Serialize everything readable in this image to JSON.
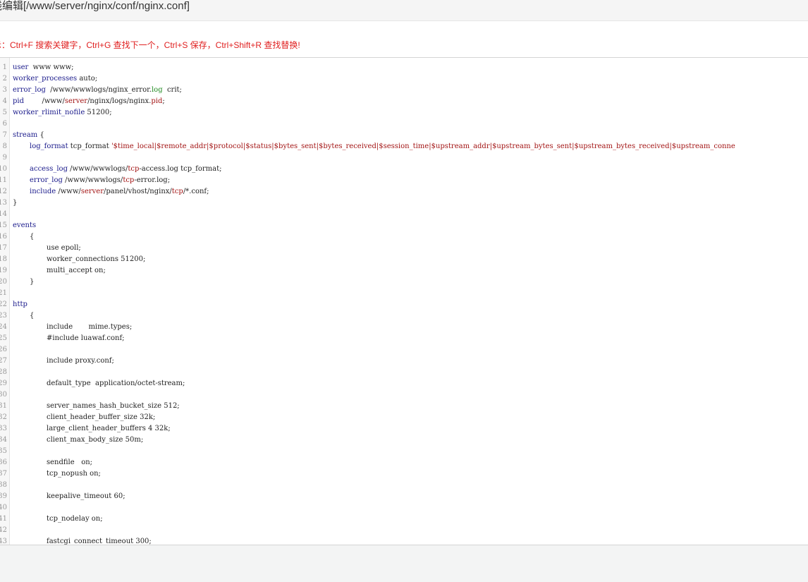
{
  "title": "线编辑[/www/server/nginx/conf/nginx.conf]",
  "tip": "示：Ctrl+F 搜索关键字，Ctrl+G 查找下一个，Ctrl+S 保存，Ctrl+Shift+R 查找替换!",
  "lines": [
    {
      "n": "1",
      "indent": 0,
      "parts": [
        {
          "t": "user",
          "c": "kw"
        },
        {
          "t": "  www www;",
          "c": "pth"
        }
      ]
    },
    {
      "n": "2",
      "indent": 0,
      "parts": [
        {
          "t": "worker_processes",
          "c": "kw"
        },
        {
          "t": " auto;",
          "c": "pth"
        }
      ]
    },
    {
      "n": "3",
      "indent": 0,
      "parts": [
        {
          "t": "error_log",
          "c": "kw"
        },
        {
          "t": "  /www/wwwlogs/nginx_error.",
          "c": "pth"
        },
        {
          "t": "log",
          "c": "grn"
        },
        {
          "t": "  crit;",
          "c": "pth"
        }
      ]
    },
    {
      "n": "4",
      "indent": 0,
      "parts": [
        {
          "t": "pid",
          "c": "kw"
        },
        {
          "t": "        /www/",
          "c": "pth"
        },
        {
          "t": "server",
          "c": "str"
        },
        {
          "t": "/nginx/logs/nginx.",
          "c": "pth"
        },
        {
          "t": "pid",
          "c": "str"
        },
        {
          "t": ";",
          "c": "pth"
        }
      ]
    },
    {
      "n": "5",
      "indent": 0,
      "parts": [
        {
          "t": "worker_rlimit_nofile",
          "c": "kw"
        },
        {
          "t": " 51200;",
          "c": "pth"
        }
      ]
    },
    {
      "n": "6",
      "indent": 0,
      "parts": []
    },
    {
      "n": "7",
      "indent": 0,
      "parts": [
        {
          "t": "stream",
          "c": "kw"
        },
        {
          "t": " {",
          "c": "pth"
        }
      ]
    },
    {
      "n": "8",
      "indent": 1,
      "parts": [
        {
          "t": "log_format",
          "c": "kw"
        },
        {
          "t": " tcp_format ",
          "c": "pth"
        },
        {
          "t": "'$time_local|$remote_addr|$protocol|$status|$bytes_sent|$bytes_received|$session_time|$upstream_addr|$upstream_bytes_sent|$upstream_bytes_received|$upstream_conne",
          "c": "str"
        }
      ]
    },
    {
      "n": "9",
      "indent": 0,
      "parts": []
    },
    {
      "n": "10",
      "indent": 1,
      "parts": [
        {
          "t": "access_log",
          "c": "kw"
        },
        {
          "t": " /www/wwwlogs/",
          "c": "pth"
        },
        {
          "t": "tcp",
          "c": "str"
        },
        {
          "t": "-access.log tcp_format;",
          "c": "pth"
        }
      ]
    },
    {
      "n": "11",
      "indent": 1,
      "parts": [
        {
          "t": "error_log",
          "c": "kw"
        },
        {
          "t": " /www/wwwlogs/",
          "c": "pth"
        },
        {
          "t": "tcp",
          "c": "str"
        },
        {
          "t": "-error.log;",
          "c": "pth"
        }
      ]
    },
    {
      "n": "12",
      "indent": 1,
      "parts": [
        {
          "t": "include",
          "c": "kw"
        },
        {
          "t": " /www/",
          "c": "pth"
        },
        {
          "t": "server",
          "c": "str"
        },
        {
          "t": "/panel/vhost/nginx/",
          "c": "pth"
        },
        {
          "t": "tcp",
          "c": "str"
        },
        {
          "t": "/*.conf;",
          "c": "pth"
        }
      ]
    },
    {
      "n": "13",
      "indent": 0,
      "parts": [
        {
          "t": "}",
          "c": "pth"
        }
      ]
    },
    {
      "n": "14",
      "indent": 0,
      "parts": []
    },
    {
      "n": "15",
      "indent": 0,
      "parts": [
        {
          "t": "events",
          "c": "kw"
        }
      ]
    },
    {
      "n": "16",
      "indent": 1,
      "parts": [
        {
          "t": "{",
          "c": "pth"
        }
      ]
    },
    {
      "n": "17",
      "indent": 2,
      "parts": [
        {
          "t": "use epoll;",
          "c": "pth"
        }
      ]
    },
    {
      "n": "18",
      "indent": 2,
      "parts": [
        {
          "t": "worker_connections 51200;",
          "c": "pth"
        }
      ]
    },
    {
      "n": "19",
      "indent": 2,
      "parts": [
        {
          "t": "multi_accept on;",
          "c": "pth"
        }
      ]
    },
    {
      "n": "20",
      "indent": 1,
      "parts": [
        {
          "t": "}",
          "c": "pth"
        }
      ]
    },
    {
      "n": "21",
      "indent": 0,
      "parts": []
    },
    {
      "n": "22",
      "indent": 0,
      "parts": [
        {
          "t": "http",
          "c": "kw"
        }
      ]
    },
    {
      "n": "23",
      "indent": 1,
      "parts": [
        {
          "t": "{",
          "c": "pth"
        }
      ]
    },
    {
      "n": "24",
      "indent": 2,
      "parts": [
        {
          "t": "include       mime.types;",
          "c": "pth"
        }
      ]
    },
    {
      "n": "25",
      "indent": 2,
      "parts": [
        {
          "t": "#include luawaf.conf;",
          "c": "pth"
        }
      ]
    },
    {
      "n": "26",
      "indent": 0,
      "parts": []
    },
    {
      "n": "27",
      "indent": 2,
      "parts": [
        {
          "t": "include proxy.conf;",
          "c": "pth"
        }
      ]
    },
    {
      "n": "28",
      "indent": 0,
      "parts": []
    },
    {
      "n": "29",
      "indent": 2,
      "parts": [
        {
          "t": "default_type  application/octet-stream;",
          "c": "pth"
        }
      ]
    },
    {
      "n": "30",
      "indent": 0,
      "parts": []
    },
    {
      "n": "31",
      "indent": 2,
      "parts": [
        {
          "t": "server_names_hash_bucket_size 512;",
          "c": "pth"
        }
      ]
    },
    {
      "n": "32",
      "indent": 2,
      "parts": [
        {
          "t": "client_header_buffer_size 32k;",
          "c": "pth"
        }
      ]
    },
    {
      "n": "33",
      "indent": 2,
      "parts": [
        {
          "t": "large_client_header_buffers 4 32k;",
          "c": "pth"
        }
      ]
    },
    {
      "n": "34",
      "indent": 2,
      "parts": [
        {
          "t": "client_max_body_size 50m;",
          "c": "pth"
        }
      ]
    },
    {
      "n": "35",
      "indent": 0,
      "parts": []
    },
    {
      "n": "36",
      "indent": 2,
      "parts": [
        {
          "t": "sendfile   on;",
          "c": "pth"
        }
      ]
    },
    {
      "n": "37",
      "indent": 2,
      "parts": [
        {
          "t": "tcp_nopush on;",
          "c": "pth"
        }
      ]
    },
    {
      "n": "38",
      "indent": 0,
      "parts": []
    },
    {
      "n": "39",
      "indent": 2,
      "parts": [
        {
          "t": "keepalive_timeout 60;",
          "c": "pth"
        }
      ]
    },
    {
      "n": "40",
      "indent": 0,
      "parts": []
    },
    {
      "n": "41",
      "indent": 2,
      "parts": [
        {
          "t": "tcp_nodelay on;",
          "c": "pth"
        }
      ]
    },
    {
      "n": "42",
      "indent": 0,
      "parts": []
    },
    {
      "n": "43",
      "indent": 2,
      "parts": [
        {
          "t": "fastcgi_connect_timeout 300;",
          "c": "pth"
        }
      ]
    }
  ]
}
